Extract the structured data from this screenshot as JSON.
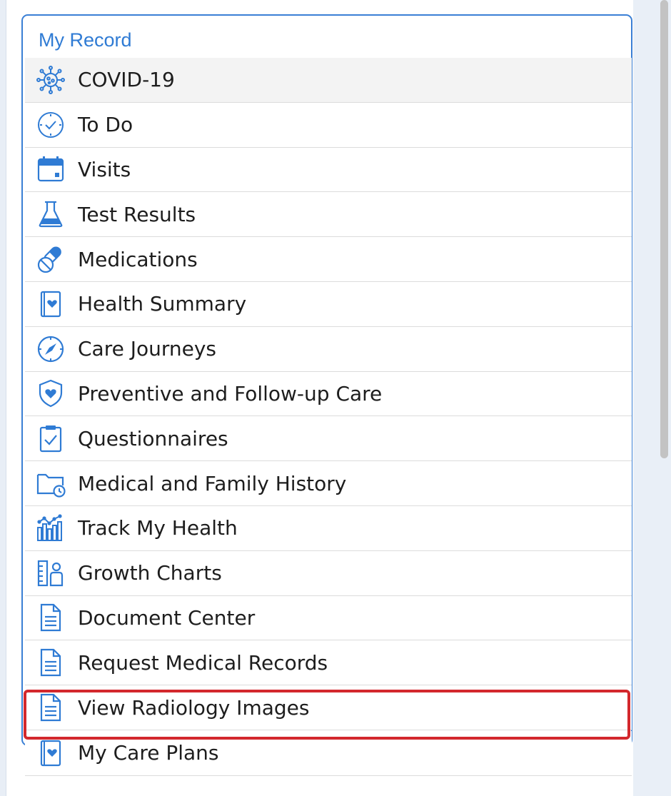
{
  "panel": {
    "title": "My Record"
  },
  "menu": {
    "items": [
      {
        "label": "COVID-19",
        "icon": "covid-virus-icon"
      },
      {
        "label": "To Do",
        "icon": "clock-check-icon"
      },
      {
        "label": "Visits",
        "icon": "calendar-icon"
      },
      {
        "label": "Test Results",
        "icon": "flask-icon"
      },
      {
        "label": "Medications",
        "icon": "pills-icon"
      },
      {
        "label": "Health Summary",
        "icon": "health-book-icon"
      },
      {
        "label": "Care Journeys",
        "icon": "compass-icon"
      },
      {
        "label": "Preventive and Follow-up Care",
        "icon": "shield-heart-icon"
      },
      {
        "label": "Questionnaires",
        "icon": "clipboard-check-icon"
      },
      {
        "label": "Medical and Family History",
        "icon": "folder-clock-icon"
      },
      {
        "label": "Track My Health",
        "icon": "bar-chart-icon"
      },
      {
        "label": "Growth Charts",
        "icon": "growth-chart-icon"
      },
      {
        "label": "Document Center",
        "icon": "document-icon"
      },
      {
        "label": "Request Medical Records",
        "icon": "document-icon"
      },
      {
        "label": "View Radiology Images",
        "icon": "document-icon"
      },
      {
        "label": "My Care Plans",
        "icon": "health-book-icon"
      }
    ]
  },
  "colors": {
    "accent": "#2f7bd4",
    "highlight": "#d3282d",
    "text": "#1d1d1d"
  }
}
